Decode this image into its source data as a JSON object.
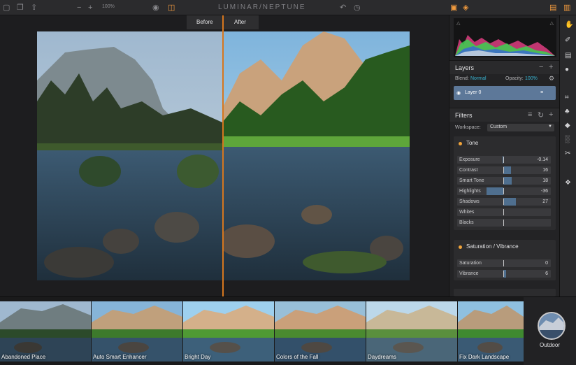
{
  "app": {
    "title": "LUMINAR/NEPTUNE",
    "zoom": "100%",
    "accent": "#f09a3e"
  },
  "toolbar": {
    "icons_left": [
      "folder-icon",
      "layers-stack-icon",
      "share-icon",
      "zoom-out-icon",
      "zoom-in-icon"
    ],
    "minus": "−",
    "plus": "+",
    "icons_center": [
      "eye-icon",
      "compare-icon"
    ],
    "icons_right": [
      "undo-icon",
      "history-icon"
    ]
  },
  "compare": {
    "before": "Before",
    "after": "After"
  },
  "layers": {
    "title": "Layers",
    "blend_label": "Blend:",
    "blend_value": "Normal",
    "opacity_label": "Opacity:",
    "opacity_value": "100%",
    "layer_name": "Layer 0"
  },
  "filters": {
    "title": "Filters",
    "workspace_label": "Workspace:",
    "workspace_value": "Custom",
    "groups": [
      {
        "title": "Tone",
        "sliders": [
          {
            "label": "Exposure",
            "value": "-0.14",
            "pct": -0.02
          },
          {
            "label": "Contrast",
            "value": "16",
            "pct": 0.16
          },
          {
            "label": "Smart Tone",
            "value": "18",
            "pct": 0.18
          },
          {
            "label": "Highlights",
            "value": "-36",
            "pct": -0.36
          },
          {
            "label": "Shadows",
            "value": "27",
            "pct": 0.27
          },
          {
            "label": "Whites",
            "value": "",
            "pct": 0
          },
          {
            "label": "Blacks",
            "value": "",
            "pct": 0
          }
        ]
      },
      {
        "title": "Saturation / Vibrance",
        "sliders": [
          {
            "label": "Saturation",
            "value": "0",
            "pct": 0
          },
          {
            "label": "Vibrance",
            "value": "6",
            "pct": 0.06
          }
        ]
      }
    ]
  },
  "presets": [
    "Abandoned Place",
    "Auto Smart Enhancer",
    "Bright Day",
    "Colors of the Fall",
    "Daydreams",
    "Fix Dark Landscape"
  ],
  "category": "Outdoor"
}
